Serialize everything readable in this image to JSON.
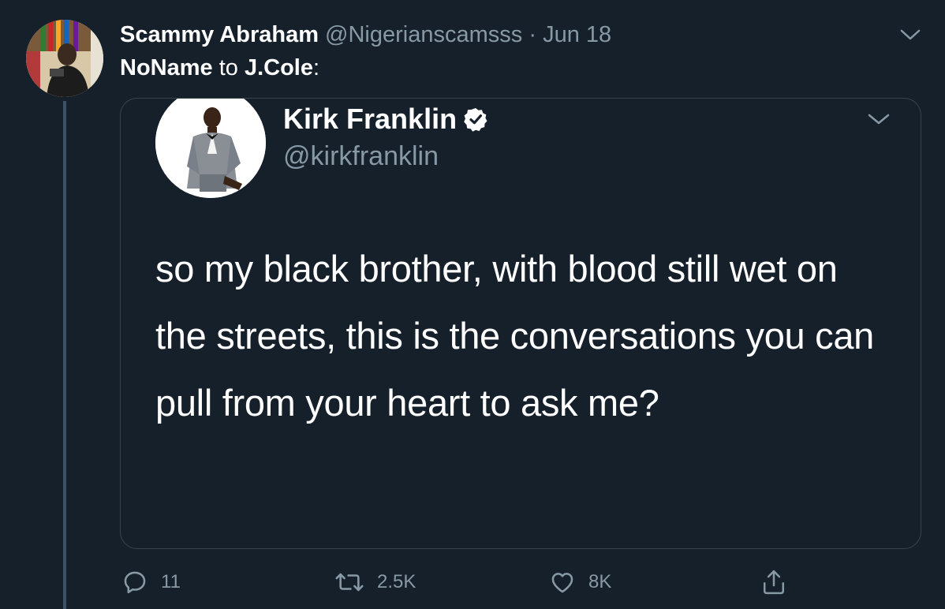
{
  "tweet": {
    "display_name": "Scammy Abraham",
    "handle": "@Nigerianscamsss",
    "separator": "·",
    "date": "Jun 18",
    "context_from": "NoName",
    "context_to": "to",
    "context_target": "J.Cole",
    "context_colon": ":"
  },
  "quoted": {
    "display_name": "Kirk Franklin",
    "handle": "@kirkfranklin",
    "text": "so my black brother, with blood still wet on the streets, this is the conversations you can pull from your heart to ask me?",
    "verified": true
  },
  "actions": {
    "reply_count": "11",
    "retweet_count": "2.5K",
    "like_count": "8K"
  },
  "colors": {
    "background": "#15202b",
    "secondary_text": "#8899a6",
    "border": "#38444d"
  },
  "icons": [
    "chevron-down-icon",
    "verified-badge-icon",
    "reply-icon",
    "retweet-icon",
    "like-icon",
    "share-icon"
  ]
}
